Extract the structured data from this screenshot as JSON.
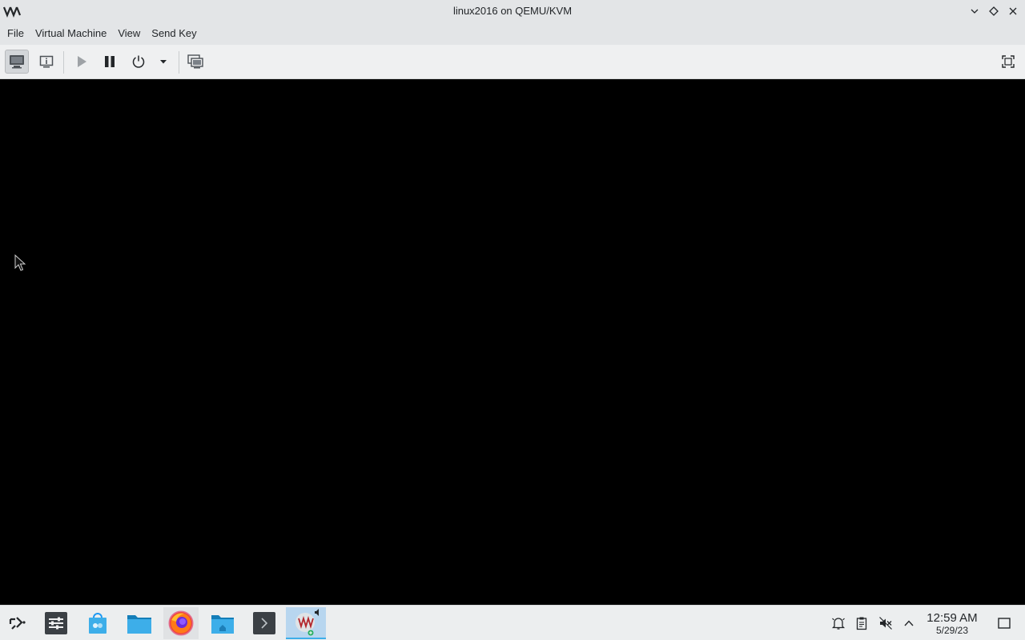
{
  "window": {
    "title": "linux2016 on QEMU/KVM",
    "app_icon": "virt-manager-logo",
    "buttons": [
      "minimize-icon",
      "maximize-icon",
      "close-icon"
    ]
  },
  "menubar": {
    "items": [
      {
        "label": "File"
      },
      {
        "label": "Virtual Machine"
      },
      {
        "label": "View"
      },
      {
        "label": "Send Key"
      }
    ]
  },
  "toolbar": {
    "items": [
      {
        "icon": "console-icon",
        "state": "active"
      },
      {
        "icon": "details-icon"
      },
      {
        "icon": "run-icon"
      },
      {
        "icon": "pause-icon"
      },
      {
        "icon": "power-icon"
      },
      {
        "icon": "dropdown-icon"
      },
      {
        "icon": "snapshots-icon"
      },
      {
        "icon": "fullscreen-icon"
      }
    ]
  },
  "taskbar": {
    "launcher_icon": "kde-launcher-icon",
    "tasks": [
      {
        "icon": "system-settings-icon"
      },
      {
        "icon": "discover-icon"
      },
      {
        "icon": "dolphin-folder-icon"
      },
      {
        "icon": "firefox-icon"
      },
      {
        "icon": "home-folder-icon"
      },
      {
        "icon": "terminal-icon"
      },
      {
        "icon": "virt-manager-icon",
        "state": "active"
      }
    ],
    "tray": [
      "notifications-icon",
      "clipboard-icon",
      "volume-muted-icon",
      "expand-tray-icon"
    ],
    "clock": {
      "time": "12:59 AM",
      "date": "5/29/23"
    },
    "show_desktop_icon": "show-desktop-icon"
  },
  "colors": {
    "titlebar": "#e3e5e7",
    "toolbar": "#eff0f1",
    "display": "#000000",
    "taskbar": "#eceeef",
    "accent": "#3daee9"
  }
}
